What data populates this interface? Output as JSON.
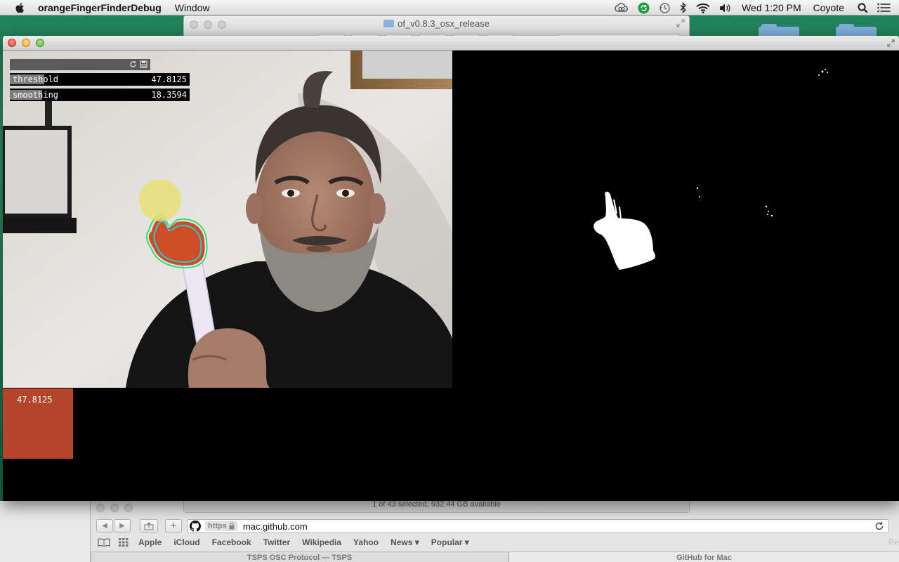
{
  "menubar": {
    "app_name": "orangeFingerFinderDebug",
    "menus": [
      "Window"
    ],
    "clock": "Wed 1:20 PM",
    "user": "Coyote",
    "status_icons": [
      "creative-cloud-icon",
      "sync-icon",
      "time-machine-icon",
      "bluetooth-icon",
      "wifi-icon",
      "volume-icon"
    ]
  },
  "finder": {
    "title": "of_v0.8.3_osx_release",
    "status": "1 of 43 selected, 932.44 GB available"
  },
  "browser": {
    "url_scheme": "https",
    "url_host": "mac.github.com",
    "reader_tail": "Re",
    "bookmarks": [
      "Apple",
      "iCloud",
      "Facebook",
      "Twitter",
      "Wikipedia",
      "Yahoo",
      "News ▾",
      "Popular ▾"
    ],
    "tabs": [
      "TSPS OSC Protocol — TSPS",
      "GitHub for Mac"
    ]
  },
  "app": {
    "gui": {
      "sliders": [
        {
          "label": "threshold",
          "value": "47.8125",
          "fill": 0.19
        },
        {
          "label": "smoothing",
          "value": "18.3594",
          "fill": 0.18
        }
      ]
    },
    "swatch_value": "47.8125",
    "swatch_color": "#b5452a",
    "tracker_color": "#e8e070",
    "contour_color": "#2ee27a"
  }
}
